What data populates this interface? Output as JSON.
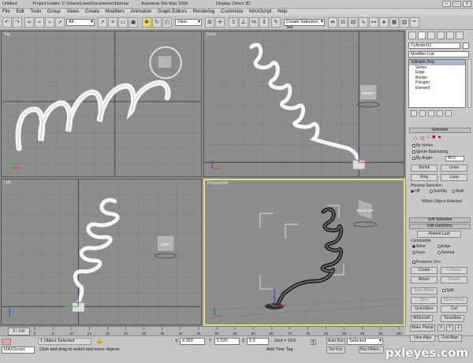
{
  "titlebar": {
    "parts": [
      "Untitled",
      "Project Folder: C:\\Users\\Love\\Documents\\3dsmax",
      "Autodesk 3ds Max 2009",
      "Display: Direct 3D"
    ]
  },
  "menubar": {
    "items": [
      "File",
      "Edit",
      "Tools",
      "Group",
      "Views",
      "Create",
      "Modifiers",
      "Animation",
      "Graph Editors",
      "Rendering",
      "Customize",
      "MAXScript",
      "Help"
    ]
  },
  "toolbar": {
    "filter_value": "All",
    "refcoord_value": "View",
    "selset_value": "Create Selection Set"
  },
  "viewports": {
    "top": {
      "label": "Top"
    },
    "front": {
      "label": "Front",
      "cube": "FRONT"
    },
    "left": {
      "label": "Left",
      "cube": "LEFT"
    },
    "perspective": {
      "label": "Perspective",
      "cube": "BACK UP"
    }
  },
  "command_panel": {
    "object_name": "Cylinder01",
    "modifier_list": "Modifier List",
    "stack": {
      "top": "Editable Poly",
      "items": [
        "Vertex",
        "Edge",
        "Border",
        "Polygon",
        "Element"
      ]
    },
    "selection": {
      "title": "Selection",
      "by_vertex": "By Vertex",
      "ignore_backfacing": "Ignore Backfacing",
      "by_angle": "By Angle:",
      "angle_value": "45.0",
      "shrink": "Shrink",
      "grow": "Grow",
      "ring": "Ring",
      "loop": "Loop",
      "preview_selection": "Preview Selection",
      "preview_off": "Off",
      "preview_subobj": "SubObj",
      "preview_multi": "Multi",
      "status": "Whole Object Selected"
    },
    "soft_selection": "Soft Selection",
    "edit_geometry": {
      "title": "Edit Geometry",
      "repeat_last": "Repeat Last",
      "constraints": "Constraints",
      "none": "None",
      "edge": "Edge",
      "face": "Face",
      "normal": "Normal",
      "preserve_uvs": "Preserve UVs",
      "create": "Create",
      "collapse": "Collapse",
      "attach": "Attach",
      "detach": "Detach",
      "slice_plane": "Slice Plane",
      "split": "Split",
      "slice": "Slice",
      "reset_plane": "Reset Plane",
      "quickslice": "QuickSlice",
      "cut": "Cut",
      "msmooth": "MSmooth",
      "tessellate": "Tessellate",
      "make_planar": "Make Planar",
      "x": "X",
      "y": "Y",
      "z": "Z",
      "view_align": "View Align",
      "grid_align": "Grid Align"
    }
  },
  "timeline": {
    "frame_display": "0 / 100",
    "tick_labels": [
      "0",
      "5",
      "10",
      "15",
      "20",
      "25",
      "30",
      "35",
      "40",
      "45",
      "50",
      "55",
      "60",
      "65",
      "70",
      "75",
      "80",
      "85",
      "90",
      "95",
      "100"
    ]
  },
  "statusbar": {
    "maxscript": "MAXScript.",
    "selected": "1 Object Selected",
    "prompt": "Click and drag to select and move objects",
    "x_value": "4.059",
    "y_value": "5.535",
    "z_value": "0.0",
    "grid": "Grid = 10.0",
    "add_time_tag": "Add Time Tag",
    "auto_key": "Auto Key",
    "selected_dropdown": "Selected",
    "set_key": "Set Key",
    "key_filters": "Key Filters..."
  },
  "watermark": "pxleyes.com",
  "colors": {
    "active_viewport": "#e6e06b",
    "viewport_bg": "#8d8d8d",
    "spiral": "#f5f5f5"
  }
}
